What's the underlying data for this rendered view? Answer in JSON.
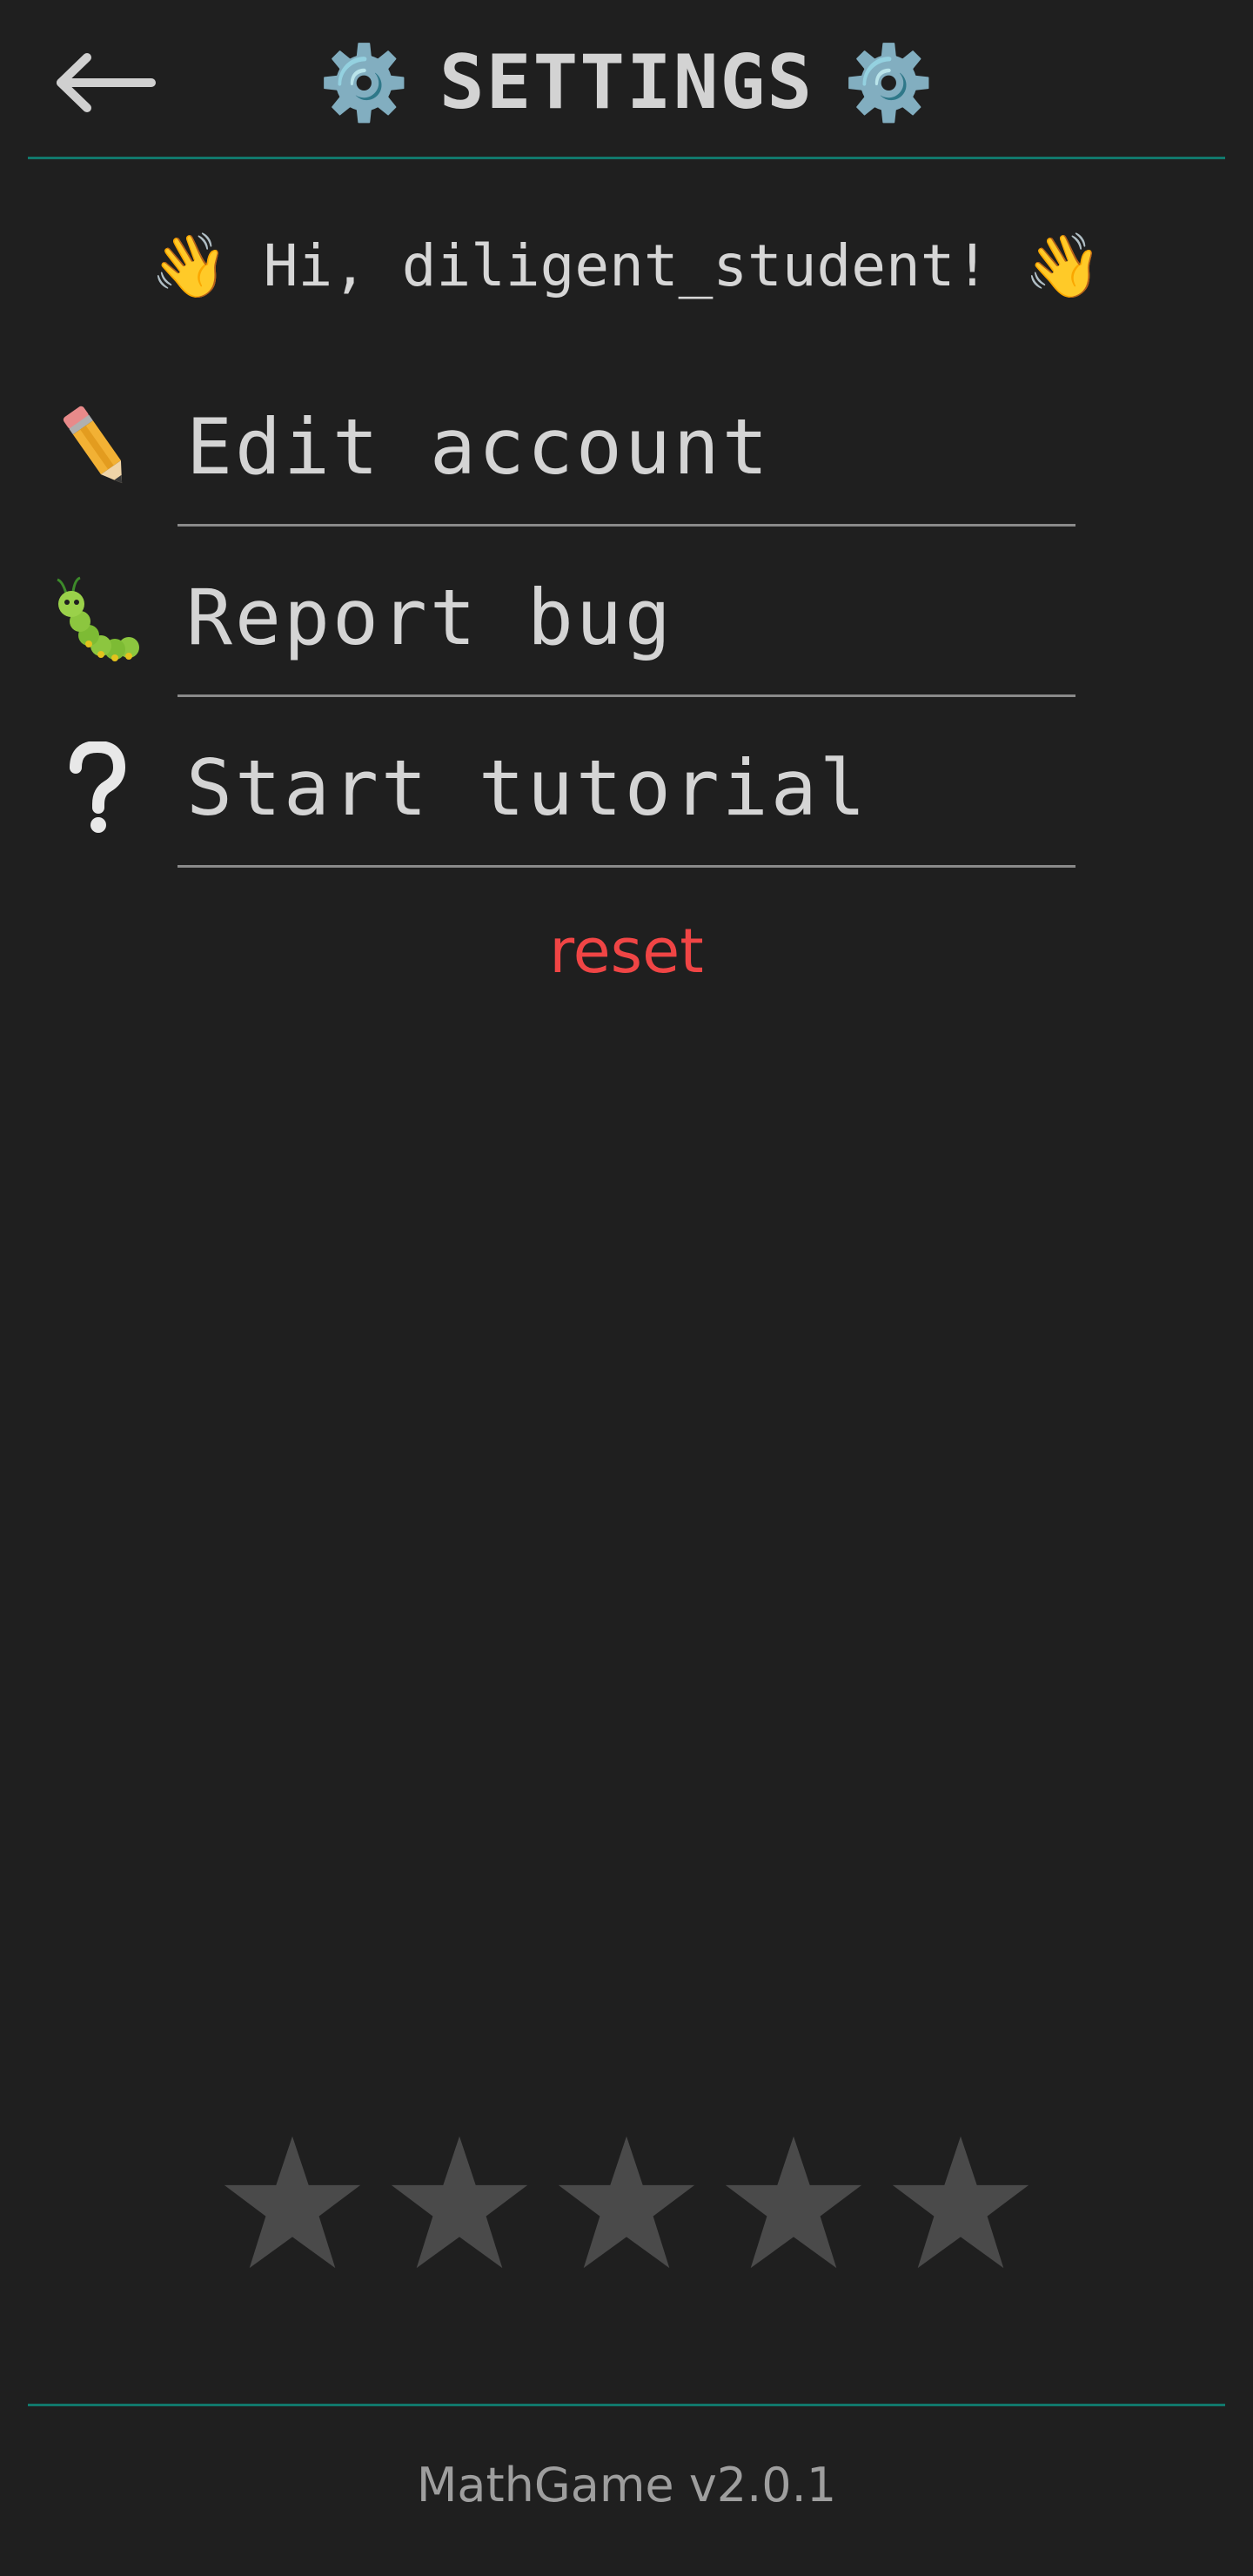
{
  "header": {
    "back_icon": "arrow-left-icon",
    "title": "SETTINGS",
    "gear_icon": "⚙️",
    "accent_color": "#11786c"
  },
  "greeting": {
    "text": "Hi, diligent_student!",
    "wave_icon": "👋"
  },
  "menu": [
    {
      "label": "Edit account",
      "icon": "pencil-icon"
    },
    {
      "label": "Report bug",
      "icon": "caterpillar-icon"
    },
    {
      "label": "Start tutorial",
      "icon": "question-mark-icon"
    }
  ],
  "reset": {
    "label": "reset",
    "color": "#f04545"
  },
  "rating": {
    "value": 0,
    "max": 5,
    "star_color": "#4a4a4a"
  },
  "footer": {
    "version_text": "MathGame v2.0.1"
  }
}
